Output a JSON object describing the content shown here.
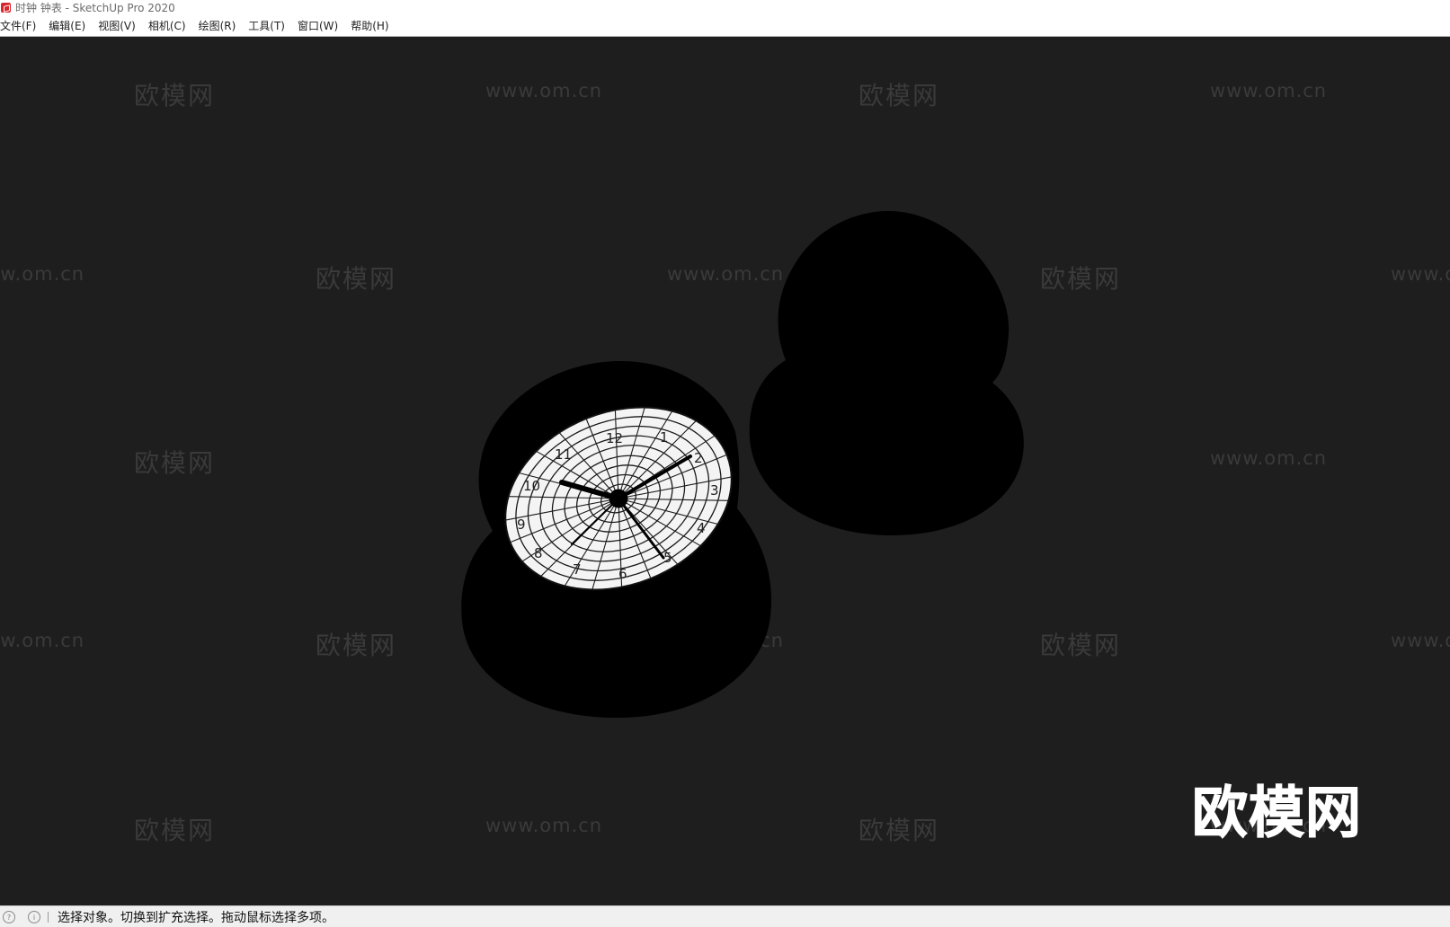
{
  "window": {
    "title": "时钟 钟表 - SketchUp Pro 2020",
    "app_icon": "sketchup-logo-icon"
  },
  "menu": {
    "items": [
      {
        "label": "文件(F)"
      },
      {
        "label": "编辑(E)"
      },
      {
        "label": "视图(V)"
      },
      {
        "label": "相机(C)"
      },
      {
        "label": "绘图(R)"
      },
      {
        "label": "工具(T)"
      },
      {
        "label": "窗口(W)"
      },
      {
        "label": "帮助(H)"
      }
    ]
  },
  "viewport": {
    "background_color": "#1e1e1e",
    "model_color": "#000000",
    "dial_color": "#ffffff",
    "watermark_url": "www.om.cn",
    "watermark_cn": "欧模网",
    "watermark_big": "欧模网",
    "clock_numerals": [
      "12",
      "1",
      "2",
      "3",
      "4",
      "5",
      "6",
      "7",
      "8",
      "9",
      "10",
      "11"
    ]
  },
  "statusbar": {
    "icons": [
      "geo-location-icon",
      "info-icon"
    ],
    "message": "选择对象。切换到扩充选择。拖动鼠标选择多项。"
  }
}
